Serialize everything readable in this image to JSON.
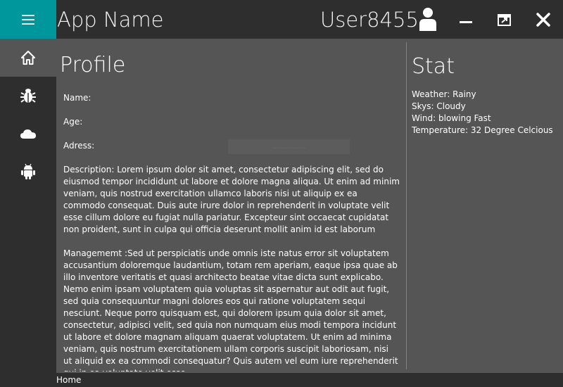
{
  "header": {
    "app_title": "App Name",
    "user_name": "User8455",
    "menu_icon": "hamburger-menu-icon",
    "user_icon": "user-icon",
    "controls": [
      "minimize-icon",
      "maximize-icon",
      "close-icon"
    ],
    "accent_color": "#00979c"
  },
  "sidebar": {
    "items": [
      {
        "icon": "home-icon",
        "active": true
      },
      {
        "icon": "bug-icon",
        "active": false
      },
      {
        "icon": "cloud-icon",
        "active": false
      },
      {
        "icon": "android-icon",
        "active": false
      }
    ]
  },
  "profile": {
    "title": "Profile",
    "name_label": "Name:",
    "age_label": "Age:",
    "address_label": "Adress:",
    "ghost_text": "...............",
    "description": "Description: Lorem ipsum dolor sit amet, consectetur adipiscing elit, sed do eiusmod tempor incididunt ut labore et dolore magna aliqua. Ut enim ad minim veniam, quis nostrud exercitation ullamco laboris nisi ut aliquip ex ea commodo consequat. Duis aute irure dolor in reprehenderit in voluptate velit esse cillum dolore eu fugiat nulla pariatur. Excepteur sint occaecat cupidatat non proident, sunt in culpa qui officia deserunt mollit anim id est laborum",
    "management": "Managememt :Sed ut perspiciatis unde omnis iste natus error sit voluptatem accusantium doloremque laudantium, totam rem aperiam, eaque ipsa quae ab illo inventore veritatis et quasi architecto beatae vitae dicta sunt explicabo. Nemo enim ipsam voluptatem quia voluptas sit aspernatur aut odit aut fugit, sed quia consequuntur magni dolores eos qui ratione voluptatem sequi nesciunt. Neque porro quisquam est, qui dolorem ipsum quia dolor sit amet, consectetur, adipisci velit, sed quia non numquam eius modi tempora incidunt ut labore et dolore magnam aliquam quaerat voluptatem. Ut enim ad minima veniam, quis nostrum exercitationem ullam corporis suscipit laboriosam, nisi ut aliquid ex ea commodi consequatur? Quis autem vel eum iure reprehenderit qui in ea voluptate velit esse"
  },
  "stat": {
    "title": "Stat",
    "lines": [
      "Weather: Rainy",
      "Skys: Cloudy",
      "Wind: blowing Fast",
      "Temperature: 32 Degree Celcious"
    ]
  },
  "statusbar": {
    "text": "Home"
  }
}
